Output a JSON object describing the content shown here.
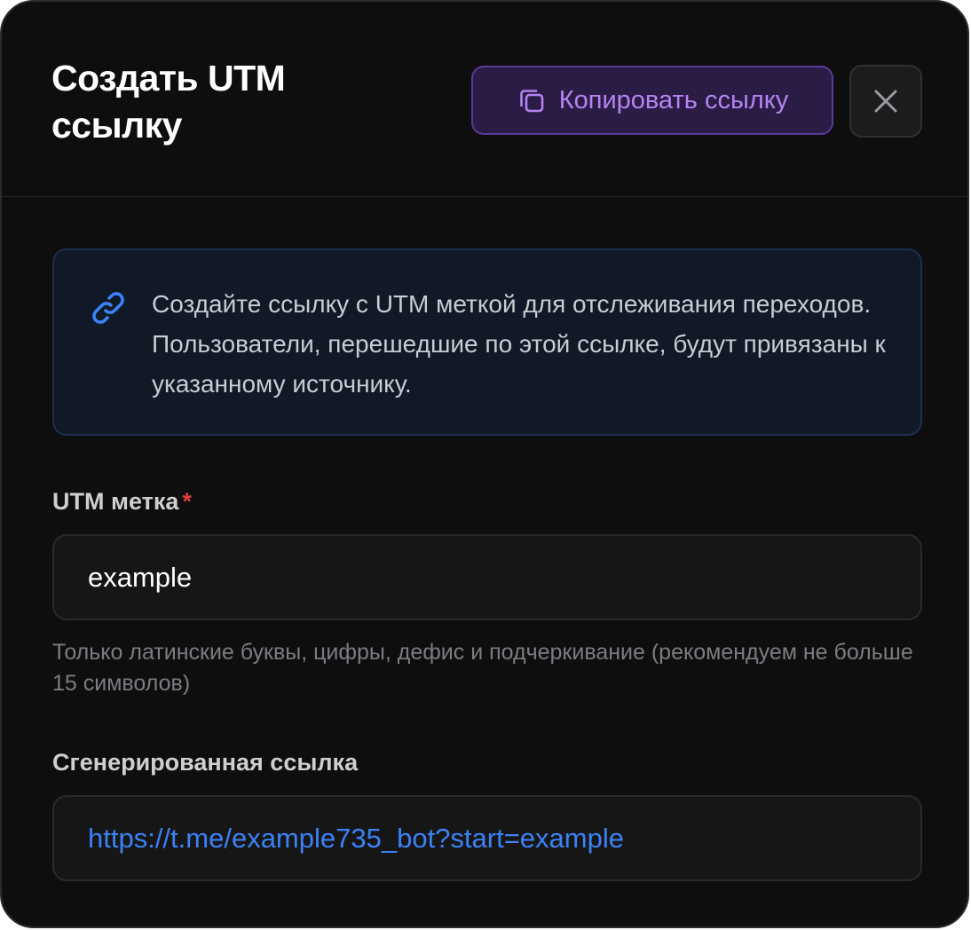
{
  "modal": {
    "title": "Создать UTM\nссылку",
    "copy_button_label": "Копировать ссылку",
    "copy_icon": "copy-icon",
    "close_icon": "close-icon"
  },
  "info": {
    "icon": "link-icon",
    "text": "Создайте ссылку с UTM меткой для отслеживания переходов. Пользователи, перешедшие по этой ссылке, будут привязаны к указанному источнику."
  },
  "utm_field": {
    "label": "UTM метка",
    "required_marker": "*",
    "value": "example",
    "helper": "Только латинские буквы, цифры, дефис и подчеркивание (рекомендуем не больше 15 символов)"
  },
  "generated_field": {
    "label": "Сгенерированная ссылка",
    "value": "https://t.me/example735_bot?start=example"
  },
  "colors": {
    "background": "#0e0e0f",
    "accent_purple": "#b484f4",
    "link_blue": "#3b82f6",
    "required_red": "#e0403c"
  }
}
